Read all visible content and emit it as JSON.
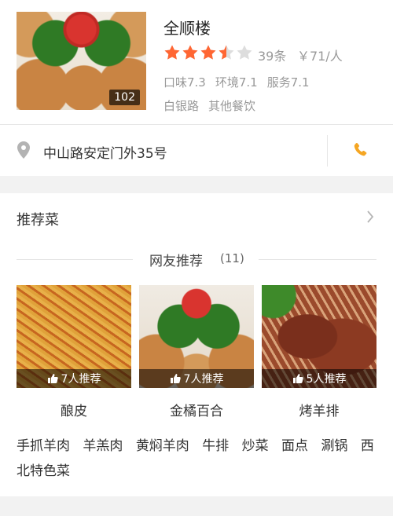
{
  "restaurant": {
    "name": "全顺楼",
    "photo_count": "102",
    "rating": 3.5,
    "rating_max": 5,
    "reviews": "39条",
    "price": "￥71/人",
    "scores": [
      "口味7.3",
      "环境7.1",
      "服务7.1"
    ],
    "tags": [
      "白银路",
      "其他餐饮"
    ]
  },
  "address": {
    "text": "中山路安定门外35号",
    "icons": {
      "location": "map-pin-icon",
      "phone": "phone-icon"
    }
  },
  "recommended": {
    "title": "推荐菜",
    "netizen_label": "网友推荐",
    "netizen_count": "(11)",
    "dishes": [
      {
        "name": "酿皮",
        "badge": "7人推荐"
      },
      {
        "name": "金橘百合",
        "badge": "7人推荐"
      },
      {
        "name": "烤羊排",
        "badge": "5人推荐"
      }
    ],
    "more_dishes": [
      "手抓羊肉",
      "羊羔肉",
      "黄焖羊肉",
      "牛排",
      "炒菜",
      "面点",
      "涮锅",
      "西北特色菜"
    ]
  },
  "colors": {
    "star_on": "#ff6633",
    "star_off": "#dddddd",
    "phone": "#f5a623",
    "icon_gray": "#aaaaaa"
  }
}
